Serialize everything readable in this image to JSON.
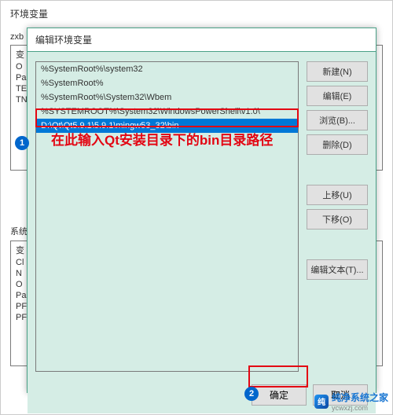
{
  "bg_window": {
    "title": "环境变量",
    "user_label": "zxb",
    "user_header": "变",
    "user_items": [
      "O",
      "Pa",
      "TE",
      "TN"
    ],
    "sys_label": "系统",
    "sys_header": "变",
    "sys_items": [
      "Cl",
      "N",
      "O",
      "Pa",
      "PF",
      "PF"
    ]
  },
  "modal": {
    "title": "编辑环境变量",
    "list": [
      "%SystemRoot%\\system32",
      "%SystemRoot%",
      "%SystemRoot%\\System32\\Wbem",
      "%SYSTEMROOT%\\System32\\WindowsPowerShell\\v1.0\\",
      "D:\\Qt\\Qt5.9.1\\5.9.1\\mingw53_32\\bin"
    ],
    "selected_index": 4,
    "buttons": {
      "new": "新建(N)",
      "edit": "编辑(E)",
      "browse": "浏览(B)...",
      "delete": "删除(D)",
      "move_up": "上移(U)",
      "move_down": "下移(O)",
      "edit_text": "编辑文本(T)..."
    },
    "footer": {
      "ok": "确定",
      "cancel": "取消"
    }
  },
  "annotation": {
    "text": "在此输入Qt安装目录下的bin目录路径",
    "step1": "1",
    "step2": "2"
  },
  "watermark": {
    "title": "纯净系统之家",
    "sub": "ycwxzj.com"
  }
}
